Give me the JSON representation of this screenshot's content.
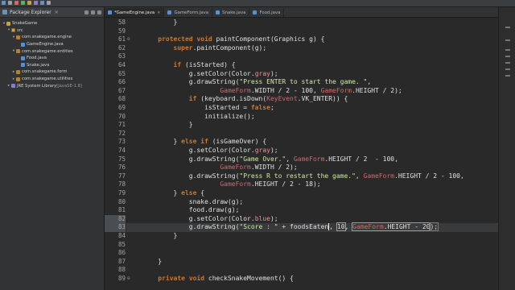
{
  "package_explorer": {
    "title": "Package Explorer",
    "close_glyph": "✕",
    "tree": [
      {
        "label": "SnakeGame",
        "indent": 0,
        "arrow": "▾",
        "icon": "project-icon"
      },
      {
        "label": "src",
        "indent": 1,
        "arrow": "▾",
        "icon": "source-folder-icon"
      },
      {
        "label": "com.snakegame.engine",
        "indent": 2,
        "arrow": "▾",
        "icon": "package-icon"
      },
      {
        "label": "GameEngine.java",
        "indent": 3,
        "arrow": "",
        "icon": "java-file-icon"
      },
      {
        "label": "com.snakegame.entities",
        "indent": 2,
        "arrow": "▾",
        "icon": "package-icon"
      },
      {
        "label": "Food.java",
        "indent": 3,
        "arrow": "",
        "icon": "java-file-icon"
      },
      {
        "label": "Snake.java",
        "indent": 3,
        "arrow": "",
        "icon": "java-file-icon"
      },
      {
        "label": "com.snakegame.form",
        "indent": 2,
        "arrow": "▸",
        "icon": "package-icon"
      },
      {
        "label": "com.snakegame.utilities",
        "indent": 2,
        "arrow": "▸",
        "icon": "package-icon"
      },
      {
        "label": "JRE System Library",
        "suffix": " [JavaSE-1.8]",
        "indent": 1,
        "arrow": "▸",
        "icon": "library-icon"
      }
    ]
  },
  "editor": {
    "tabs": [
      {
        "label": "*GameEngine.java",
        "active": true
      },
      {
        "label": "GameForm.java",
        "active": false
      },
      {
        "label": "Snake.java",
        "active": false
      },
      {
        "label": "Food.java",
        "active": false
      }
    ],
    "close_glyph": "✕",
    "lines": [
      {
        "n": "58",
        "segs": [
          [
            "        }",
            ""
          ]
        ]
      },
      {
        "n": "59",
        "segs": []
      },
      {
        "n": "61",
        "fold": "⊖",
        "segs": [
          [
            "    ",
            ""
          ],
          [
            "protected",
            "kw"
          ],
          [
            " ",
            ""
          ],
          [
            "void",
            "kw"
          ],
          [
            " paintComponent(",
            ""
          ],
          [
            "Graphics",
            ""
          ],
          [
            " g) {",
            ""
          ]
        ]
      },
      {
        "n": "62",
        "segs": [
          [
            "        ",
            ""
          ],
          [
            "super",
            "kw"
          ],
          [
            ".paintComponent(g);",
            ""
          ]
        ]
      },
      {
        "n": "63",
        "segs": []
      },
      {
        "n": "64",
        "segs": [
          [
            "        ",
            ""
          ],
          [
            "if",
            "kw"
          ],
          [
            " (isStarted) {",
            ""
          ]
        ]
      },
      {
        "n": "65",
        "segs": [
          [
            "            g.setColor(",
            ""
          ],
          [
            "Color",
            ""
          ],
          [
            ".",
            ""
          ],
          [
            "gray",
            "fld"
          ],
          [
            ");",
            ""
          ]
        ]
      },
      {
        "n": "66",
        "segs": [
          [
            "            g.drawString(",
            ""
          ],
          [
            "\"Press ENTER to start the game. \"",
            "str"
          ],
          [
            ",",
            ""
          ]
        ]
      },
      {
        "n": "67",
        "segs": [
          [
            "                    ",
            ""
          ],
          [
            "GameForm",
            "const"
          ],
          [
            ".",
            ""
          ],
          [
            "WIDTH",
            ""
          ],
          [
            " / 2 - 100, ",
            ""
          ],
          [
            "GameForm",
            "const"
          ],
          [
            ".",
            ""
          ],
          [
            "HEIGHT",
            ""
          ],
          [
            " / 2);",
            ""
          ]
        ]
      },
      {
        "n": "68",
        "segs": [
          [
            "            ",
            ""
          ],
          [
            "if",
            "kw"
          ],
          [
            " (keyboard.isDown(",
            ""
          ],
          [
            "KeyEvent",
            "const"
          ],
          [
            ".",
            ""
          ],
          [
            "VK_ENTER",
            ""
          ],
          [
            ")) {",
            ""
          ]
        ]
      },
      {
        "n": "69",
        "segs": [
          [
            "                isStarted = ",
            ""
          ],
          [
            "false",
            "kw"
          ],
          [
            ";",
            ""
          ]
        ]
      },
      {
        "n": "70",
        "segs": [
          [
            "                initialize();",
            ""
          ]
        ]
      },
      {
        "n": "71",
        "segs": [
          [
            "            }",
            ""
          ]
        ]
      },
      {
        "n": "72",
        "segs": []
      },
      {
        "n": "73",
        "segs": [
          [
            "        } ",
            ""
          ],
          [
            "else",
            "kw"
          ],
          [
            " ",
            ""
          ],
          [
            "if",
            "kw"
          ],
          [
            " (isGameOver) {",
            ""
          ]
        ]
      },
      {
        "n": "74",
        "segs": [
          [
            "            g.setColor(",
            ""
          ],
          [
            "Color",
            ""
          ],
          [
            ".",
            ""
          ],
          [
            "gray",
            "fld"
          ],
          [
            ");",
            ""
          ]
        ]
      },
      {
        "n": "75",
        "segs": [
          [
            "            g.drawString(",
            ""
          ],
          [
            "\"Game Over.\"",
            "str"
          ],
          [
            ", ",
            ""
          ],
          [
            "GameForm",
            "const"
          ],
          [
            ".",
            ""
          ],
          [
            "HEIGHT",
            ""
          ],
          [
            " / 2  - 100,",
            ""
          ]
        ]
      },
      {
        "n": "76",
        "segs": [
          [
            "                    ",
            ""
          ],
          [
            "GameForm",
            "const"
          ],
          [
            ".",
            ""
          ],
          [
            "WIDTH",
            ""
          ],
          [
            " / 2);",
            ""
          ]
        ]
      },
      {
        "n": "77",
        "segs": [
          [
            "            g.drawString(",
            ""
          ],
          [
            "\"Press R to restart the game.\"",
            "str"
          ],
          [
            ", ",
            ""
          ],
          [
            "GameForm",
            "const"
          ],
          [
            ".",
            ""
          ],
          [
            "HEIGHT",
            ""
          ],
          [
            " / 2 - 100,",
            ""
          ]
        ]
      },
      {
        "n": "78",
        "segs": [
          [
            "                    ",
            ""
          ],
          [
            "GameForm",
            "const"
          ],
          [
            ".",
            ""
          ],
          [
            "HEIGHT",
            ""
          ],
          [
            " / 2 - 18);",
            ""
          ]
        ]
      },
      {
        "n": "79",
        "segs": [
          [
            "        } ",
            ""
          ],
          [
            "else",
            "kw"
          ],
          [
            " {",
            ""
          ]
        ]
      },
      {
        "n": "80",
        "segs": [
          [
            "            snake.draw(g);",
            ""
          ]
        ]
      },
      {
        "n": "81",
        "segs": [
          [
            "            food.draw(g);",
            ""
          ]
        ]
      },
      {
        "n": "82",
        "gutter_hl": true,
        "segs": [
          [
            "            g.setColor(",
            ""
          ],
          [
            "Color",
            ""
          ],
          [
            ".",
            ""
          ],
          [
            "blue",
            "fld"
          ],
          [
            ");",
            ""
          ]
        ]
      },
      {
        "n": "83",
        "gutter_hl": true,
        "row_hl": true,
        "segs": [
          [
            "            g.drawString(",
            ""
          ],
          [
            "\"Score : \"",
            "str"
          ],
          [
            " + foodsEaten",
            ""
          ],
          [
            ",",
            "cursor"
          ],
          [
            " ",
            ""
          ],
          [
            "10",
            "boxed"
          ],
          [
            ", ",
            ""
          ],
          [
            "GameForm.HEIGHT - 20",
            "boxed-mix"
          ],
          [
            ");",
            "bracket"
          ]
        ]
      },
      {
        "n": "84",
        "segs": [
          [
            "        }",
            ""
          ]
        ]
      },
      {
        "n": "85",
        "segs": []
      },
      {
        "n": "86",
        "segs": []
      },
      {
        "n": "87",
        "segs": [
          [
            "    }",
            ""
          ]
        ]
      },
      {
        "n": "88",
        "segs": []
      },
      {
        "n": "89",
        "fold": "⊖",
        "segs": [
          [
            "    ",
            ""
          ],
          [
            "private",
            "kw"
          ],
          [
            " ",
            ""
          ],
          [
            "void",
            "kw"
          ],
          [
            " checkSnakeMovement() {",
            ""
          ]
        ]
      }
    ]
  }
}
